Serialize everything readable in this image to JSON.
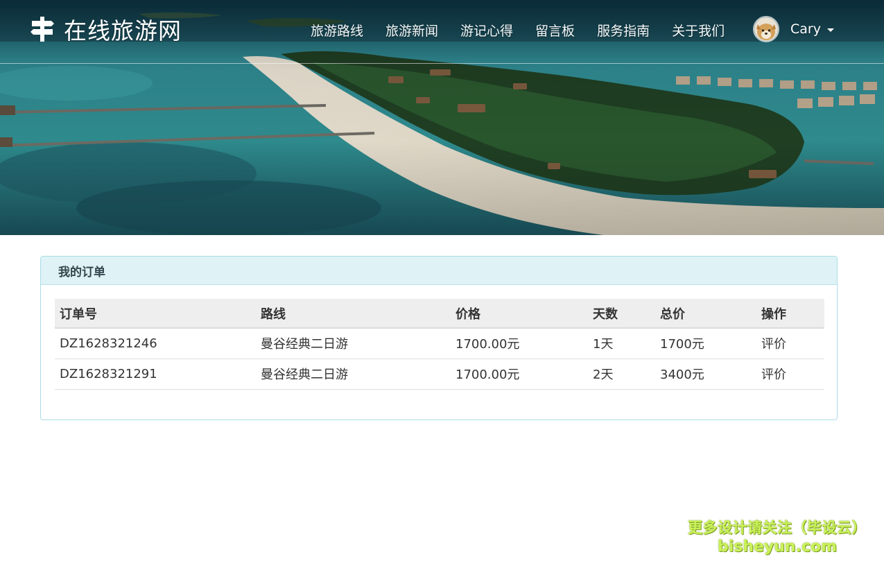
{
  "site": {
    "brand": "在线旅游网",
    "brand_icon": "signpost-icon"
  },
  "nav": {
    "items": [
      {
        "label": "旅游路线"
      },
      {
        "label": "旅游新闻"
      },
      {
        "label": "游记心得"
      },
      {
        "label": "留言板"
      },
      {
        "label": "服务指南"
      },
      {
        "label": "关于我们"
      }
    ]
  },
  "user": {
    "name": "Cary",
    "avatar": "dog-avatar",
    "dropdown_icon": "caret-down-icon"
  },
  "orders_panel": {
    "title": "我的订单",
    "columns": [
      "订单号",
      "路线",
      "价格",
      "天数",
      "总价",
      "操作"
    ],
    "rows": [
      {
        "order_no": "DZ1628321246",
        "route": "曼谷经典二日游",
        "price": "1700.00元",
        "days": "1天",
        "total": "1700元",
        "action": "评价"
      },
      {
        "order_no": "DZ1628321291",
        "route": "曼谷经典二日游",
        "price": "1700.00元",
        "days": "2天",
        "total": "3400元",
        "action": "评价"
      }
    ]
  },
  "watermark": {
    "line1": "更多设计请关注（毕设云）",
    "line2": "bisheyun.com"
  },
  "colors": {
    "panel_border": "#a9dde6",
    "panel_heading_bg": "#dff2f5",
    "table_header_bg": "#eeeeee",
    "watermark": "#c9f25a"
  }
}
